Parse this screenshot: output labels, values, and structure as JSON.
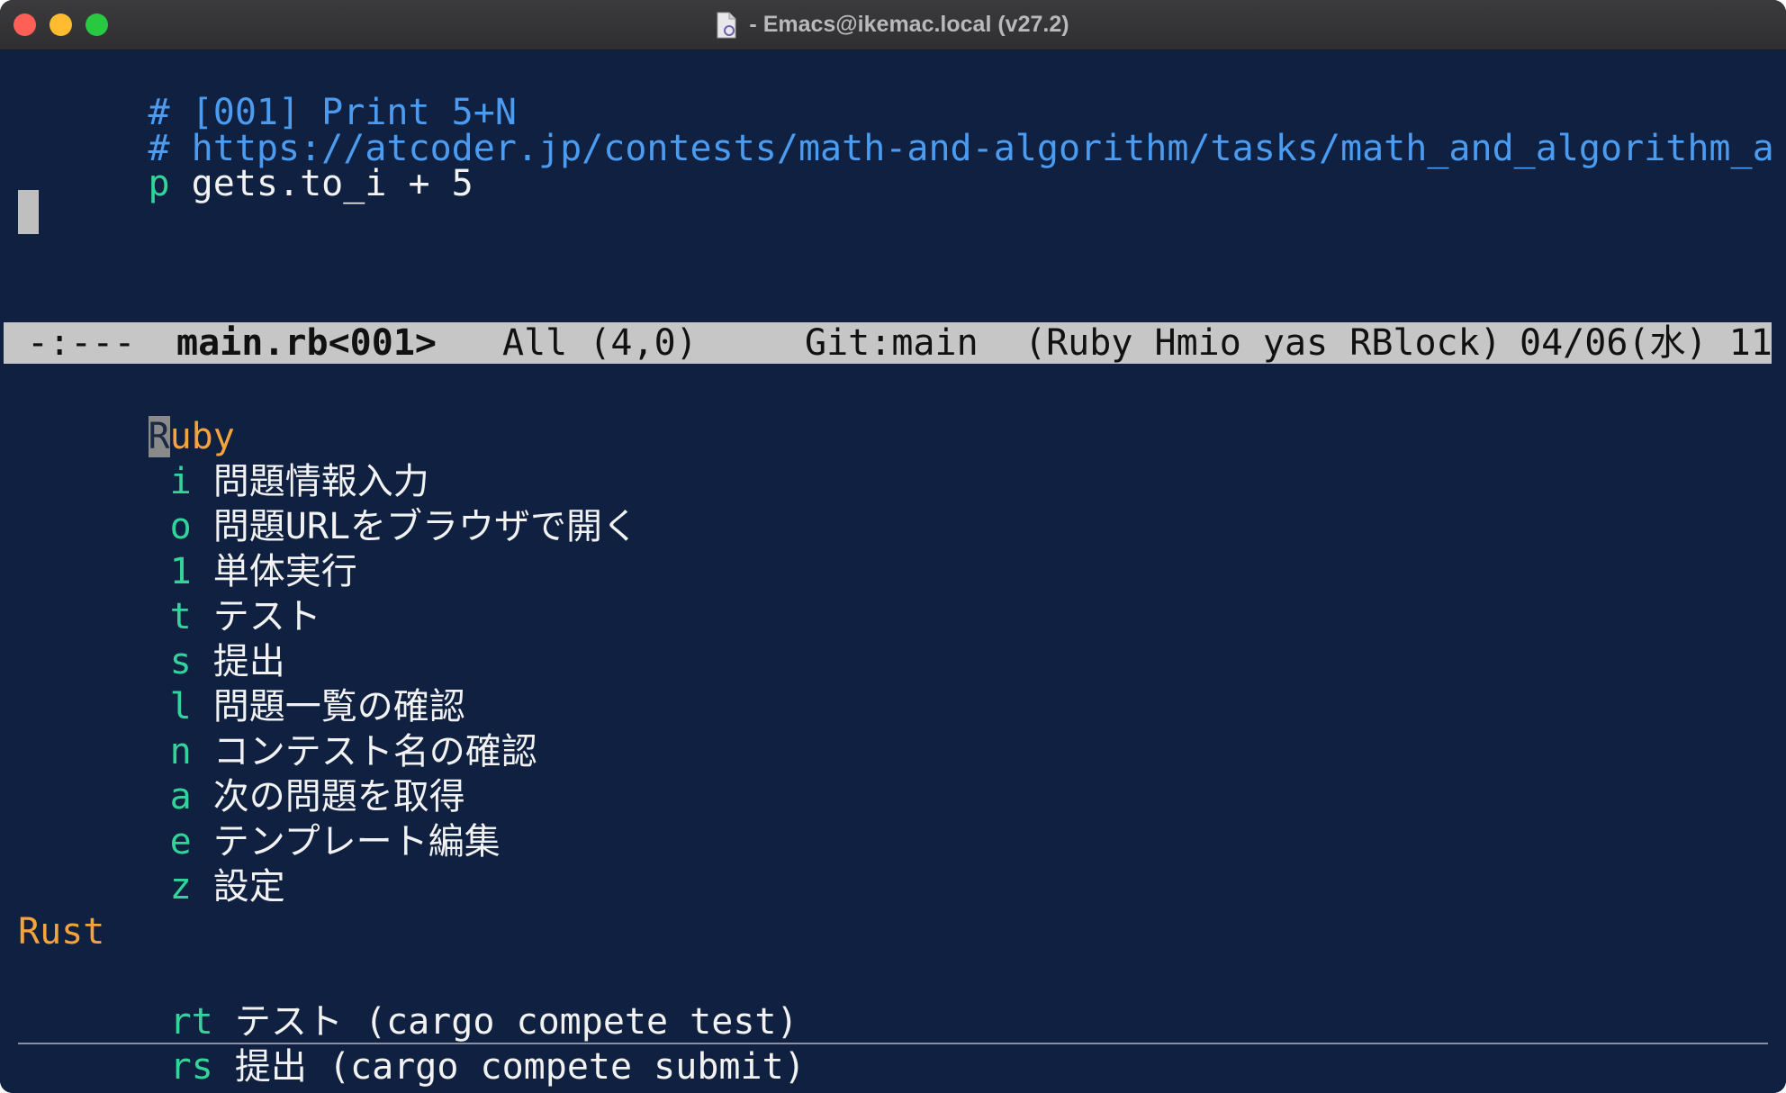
{
  "window": {
    "title": "- Emacs@ikemac.local (v27.2)",
    "controls": [
      "close",
      "minimize",
      "maximize"
    ]
  },
  "colors": {
    "background": "#0f2040",
    "comment": "#4b9cf0",
    "key": "#32d49a",
    "heading": "#f5a33a",
    "text": "#f2f2f2",
    "modeline_bg": "#c6c6c6"
  },
  "editor": {
    "lines": [
      {
        "prefix": "# ",
        "text": "[001] Print 5+N"
      },
      {
        "prefix": "# ",
        "text": "https://atcoder.jp/contests/math-and-algorithm/tasks/math_and_algorithm_a"
      },
      {
        "prefix": "p",
        "text": " gets.to_i + 5"
      }
    ]
  },
  "modeline": {
    "state": "-:---",
    "buffer": "main.rb<001>",
    "position": "All (4,0)",
    "vc": "Git:main",
    "modes": "(Ruby Hmio yas RBlock)",
    "datetime": "04/06(水) 11"
  },
  "menu": {
    "ruby_title_first": "R",
    "ruby_title_rest": "uby",
    "ruby_items": [
      {
        "key": "i",
        "label": "問題情報入力"
      },
      {
        "key": "o",
        "label": "問題URLをブラウザで開く"
      },
      {
        "key": "1",
        "label": "単体実行"
      },
      {
        "key": "t",
        "label": "テスト"
      },
      {
        "key": "s",
        "label": "提出"
      },
      {
        "key": "l",
        "label": "問題一覧の確認"
      },
      {
        "key": "n",
        "label": "コンテスト名の確認"
      },
      {
        "key": "a",
        "label": "次の問題を取得"
      },
      {
        "key": "e",
        "label": "テンプレート編集"
      },
      {
        "key": "z",
        "label": "設定"
      }
    ],
    "rust_title": "Rust",
    "rust_items": [
      {
        "key": "rt",
        "label": "テスト (cargo compete test)"
      },
      {
        "key": "rs",
        "label": "提出 (cargo compete submit)"
      }
    ]
  }
}
